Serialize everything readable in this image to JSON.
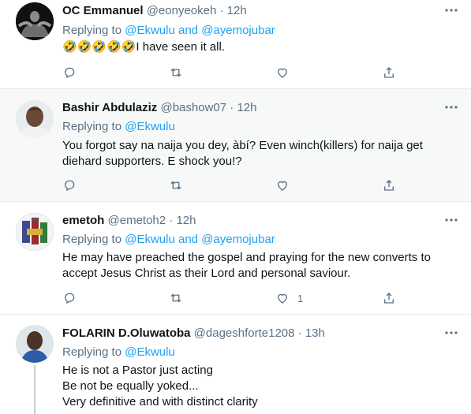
{
  "colors": {
    "link": "#1da1f2",
    "secondary": "#5b7083",
    "text": "#0f1419"
  },
  "tweets": [
    {
      "name": "OC Emmanuel",
      "handle": "@eonyeokeh",
      "sep": "·",
      "time": "12h",
      "replying_prefix": "Replying to",
      "mention1": "@Ekwulu",
      "and": "and",
      "mention2": "@ayemojubar",
      "text_emoji": "🤣🤣🤣🤣🤣",
      "text": "I have seen it all.",
      "like_count": ""
    },
    {
      "name": "Bashir Abdulaziz",
      "handle": "@bashow07",
      "sep": "·",
      "time": "12h",
      "replying_prefix": "Replying to",
      "mention1": "@Ekwulu",
      "text": "You forgot say na naija you dey, àbí? Even winch(killers) for naija get diehard supporters. E shock you!?",
      "like_count": ""
    },
    {
      "name": "emetoh",
      "handle": "@emetoh2",
      "sep": "·",
      "time": "12h",
      "replying_prefix": "Replying to",
      "mention1": "@Ekwulu",
      "and": "and",
      "mention2": "@ayemojubar",
      "text": "He may have preached the gospel and praying  for the new converts to accept Jesus Christ as their Lord and personal saviour.",
      "like_count": "1"
    },
    {
      "name": "FOLARIN D.Oluwatoba",
      "handle": "@dageshforte1208",
      "sep": "·",
      "time": "13h",
      "replying_prefix": "Replying to",
      "mention1": "@Ekwulu",
      "lines": [
        "He is not a Pastor just acting",
        "Be not be equally yoked...",
        "Very definitive and with distinct clarity"
      ]
    }
  ]
}
